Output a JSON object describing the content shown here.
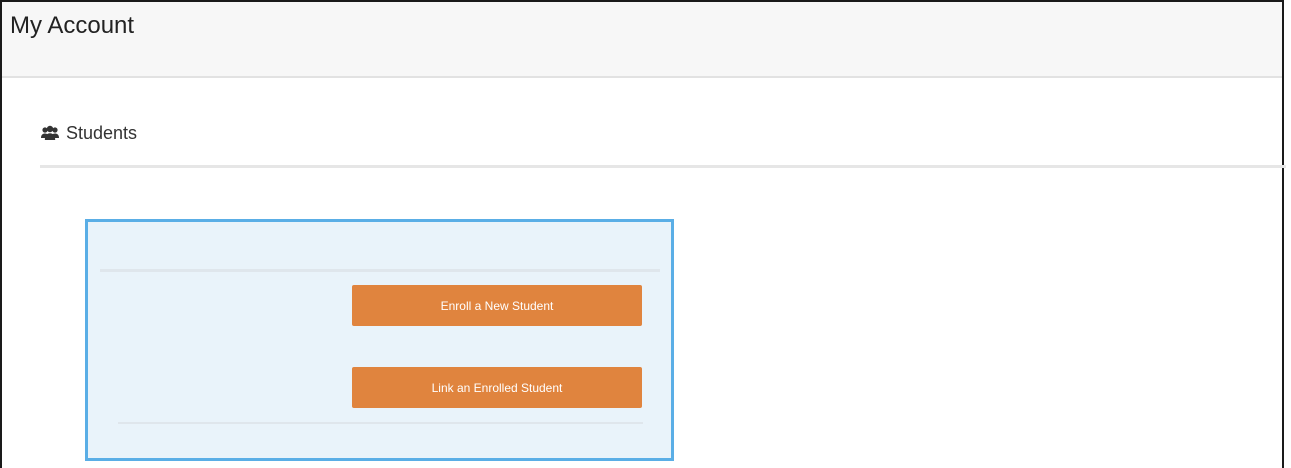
{
  "header": {
    "title": "My Account"
  },
  "students_section": {
    "heading": "Students",
    "icon": "users-icon",
    "actions": {
      "enroll_label": "Enroll a New Student",
      "link_label": "Link an Enrolled Student"
    }
  },
  "colors": {
    "button": "#e0843e",
    "panel_border": "#5aaee6",
    "panel_background": "#e9f3fa",
    "header_background": "#f7f7f7"
  }
}
